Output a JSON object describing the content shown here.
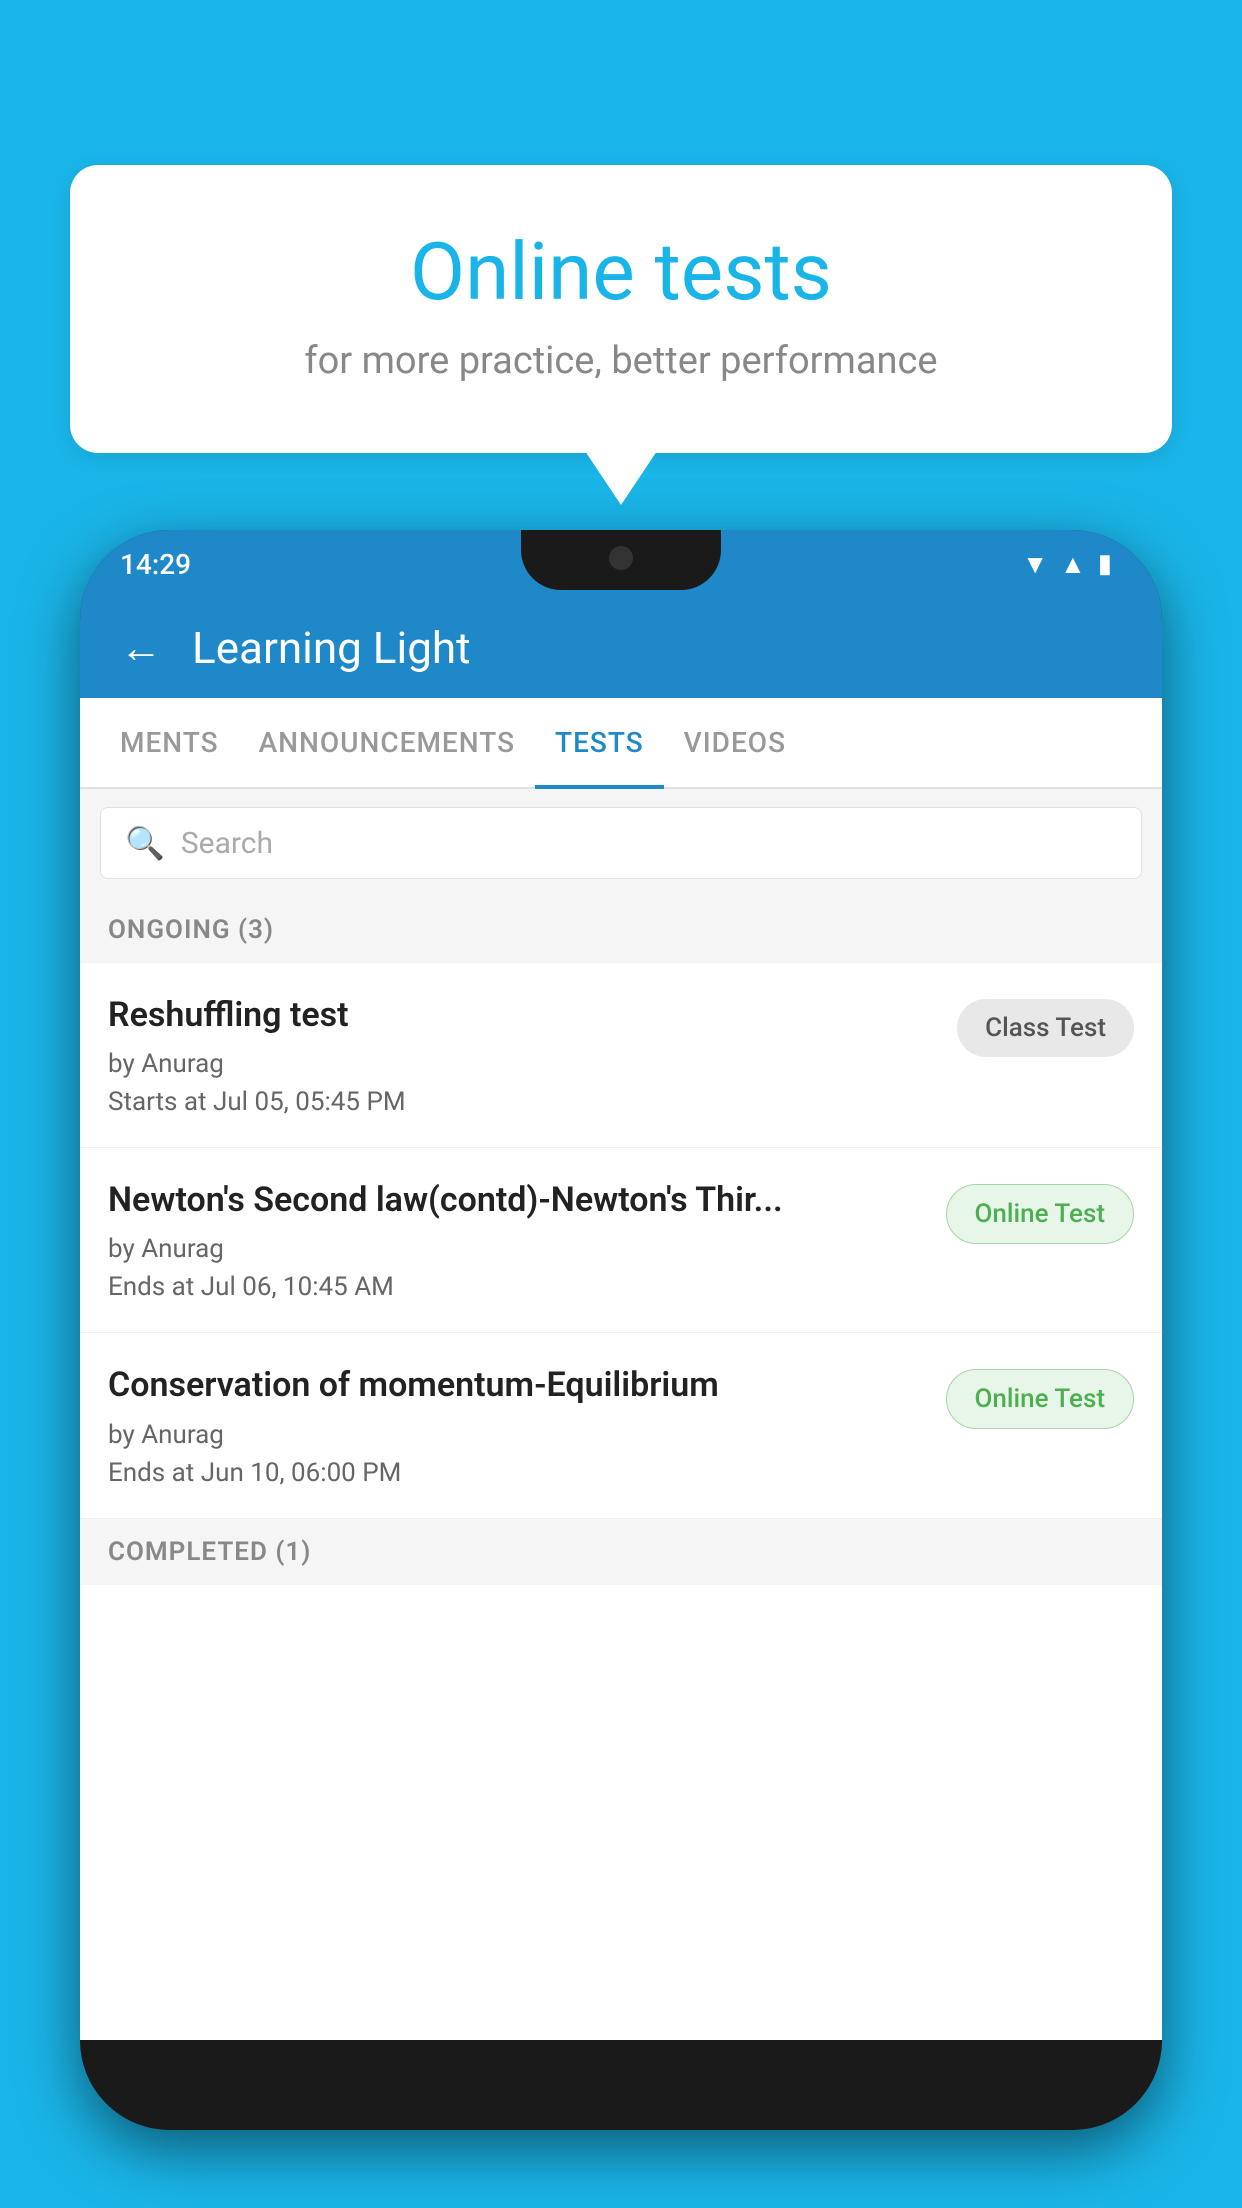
{
  "background": {
    "color": "#1ab5e8"
  },
  "speech_bubble": {
    "title": "Online tests",
    "subtitle": "for more practice, better performance"
  },
  "phone": {
    "status_bar": {
      "time": "14:29"
    },
    "app_bar": {
      "title": "Learning Light",
      "back_label": "←"
    },
    "tabs": [
      {
        "label": "MENTS",
        "active": false
      },
      {
        "label": "ANNOUNCEMENTS",
        "active": false
      },
      {
        "label": "TESTS",
        "active": true
      },
      {
        "label": "VIDEOS",
        "active": false
      }
    ],
    "search": {
      "placeholder": "Search"
    },
    "section_ongoing": {
      "label": "ONGOING (3)"
    },
    "tests": [
      {
        "title": "Reshuffling test",
        "author": "by Anurag",
        "time": "Starts at  Jul 05, 05:45 PM",
        "badge": "Class Test",
        "badge_type": "class"
      },
      {
        "title": "Newton's Second law(contd)-Newton's Thir...",
        "author": "by Anurag",
        "time": "Ends at  Jul 06, 10:45 AM",
        "badge": "Online Test",
        "badge_type": "online"
      },
      {
        "title": "Conservation of momentum-Equilibrium",
        "author": "by Anurag",
        "time": "Ends at  Jun 10, 06:00 PM",
        "badge": "Online Test",
        "badge_type": "online"
      }
    ],
    "section_completed": {
      "label": "COMPLETED (1)"
    }
  }
}
